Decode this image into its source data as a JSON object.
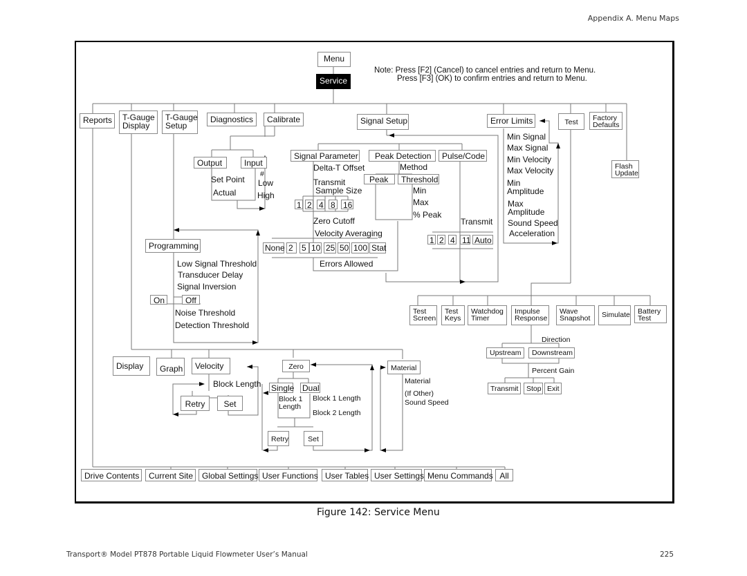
{
  "page": {
    "header": "Appendix A. Menu Maps",
    "caption": "Figure 142:  Service Menu",
    "footer_left": "Transport® Model PT878 Portable Liquid Flowmeter User’s Manual",
    "page_number": "225"
  },
  "note": {
    "line1": "Note: Press [F2] (Cancel) to cancel entries and return to Menu.",
    "line2": "Press [F3] (OK) to confirm entries and return to Menu."
  },
  "root": {
    "menu": "Menu",
    "service": "Service"
  },
  "top_level": {
    "reports": "Reports",
    "tgauge_display": [
      "T-Gauge",
      "Display"
    ],
    "tgauge_setup": [
      "T-Gauge",
      "Setup"
    ],
    "diagnostics": "Diagnostics",
    "calibrate": "Calibrate",
    "signal_setup": "Signal Setup",
    "error_limits": "Error Limits",
    "test": "Test",
    "factory_defaults": [
      "Factory",
      "Defaults"
    ],
    "flash_update": [
      "Flash",
      "Update"
    ]
  },
  "calibrate": {
    "output": "Output",
    "input": "Input",
    "output_items": [
      "Set Point",
      "Actual"
    ],
    "input_items": [
      "#",
      "Low",
      "High"
    ]
  },
  "signal_setup": {
    "signal_parameter": "Signal Parameter",
    "peak_detection": "Peak Detection",
    "pulse_code": "Pulse/Code",
    "delta_t_offset": "Delta-T Offset",
    "transmit_sample_size": [
      "Transmit",
      "Sample Size"
    ],
    "sample_sizes": [
      "1",
      "2",
      "4",
      "8",
      "16"
    ],
    "zero_cutoff": "Zero Cutoff",
    "velocity_averaging": "Velocity Averaging",
    "averaging_options": [
      "None",
      "2",
      "5",
      "10",
      "25",
      "50",
      "100",
      "Stat"
    ],
    "errors_allowed": "Errors Allowed",
    "method": "Method",
    "peak": "Peak",
    "threshold": "Threshold",
    "threshold_items": [
      "Min",
      "Max",
      "% Peak"
    ],
    "transmit": "Transmit",
    "transmit_options": [
      "1",
      "2",
      "4",
      "11",
      "Auto"
    ]
  },
  "error_limits": {
    "items": [
      "Min Signal",
      "Max Signal",
      "Min Velocity",
      "Max Velocity",
      "Min",
      "Amplitude",
      "Max",
      "Amplitude",
      "Sound Speed",
      "Acceleration"
    ]
  },
  "programming": {
    "title": "Programming",
    "items": [
      "Low Signal Threshold",
      "Transducer Delay",
      "Signal Inversion"
    ],
    "on": "On",
    "off": "Off",
    "items2": [
      "Noise Threshold",
      "Detection Threshold"
    ]
  },
  "test": {
    "items": [
      [
        "Test",
        "Screen"
      ],
      [
        "Test",
        "Keys"
      ],
      [
        "Watchdog",
        "Timer"
      ],
      [
        "Impulse",
        "Response"
      ],
      [
        "Wave",
        "Snapshot"
      ],
      [
        "Simulate"
      ],
      [
        "Battery",
        "Test"
      ]
    ],
    "direction": "Direction",
    "upstream": "Upstream",
    "downstream": "Downstream",
    "percent_gain": "Percent Gain",
    "transmit": "Transmit",
    "stop": "Stop",
    "exit": "Exit"
  },
  "tgauge": {
    "display": "Display",
    "graph": "Graph",
    "velocity": "Velocity",
    "block_length": "Block Length",
    "retry": "Retry",
    "set": "Set",
    "zero": "Zero",
    "single": "Single",
    "dual": "Dual",
    "block1_length_single": [
      "Block 1",
      "Length"
    ],
    "block1_length": "Block 1 Length",
    "block2_length": "Block 2 Length",
    "material": "Material",
    "material_items": [
      "Material",
      "(If Other)",
      "Sound Speed"
    ]
  },
  "reports": {
    "items": [
      "Drive Contents",
      "Current Site",
      "Global Settings",
      "User Functions",
      "User Tables",
      "User Settings",
      "Menu Commands",
      "All"
    ]
  }
}
